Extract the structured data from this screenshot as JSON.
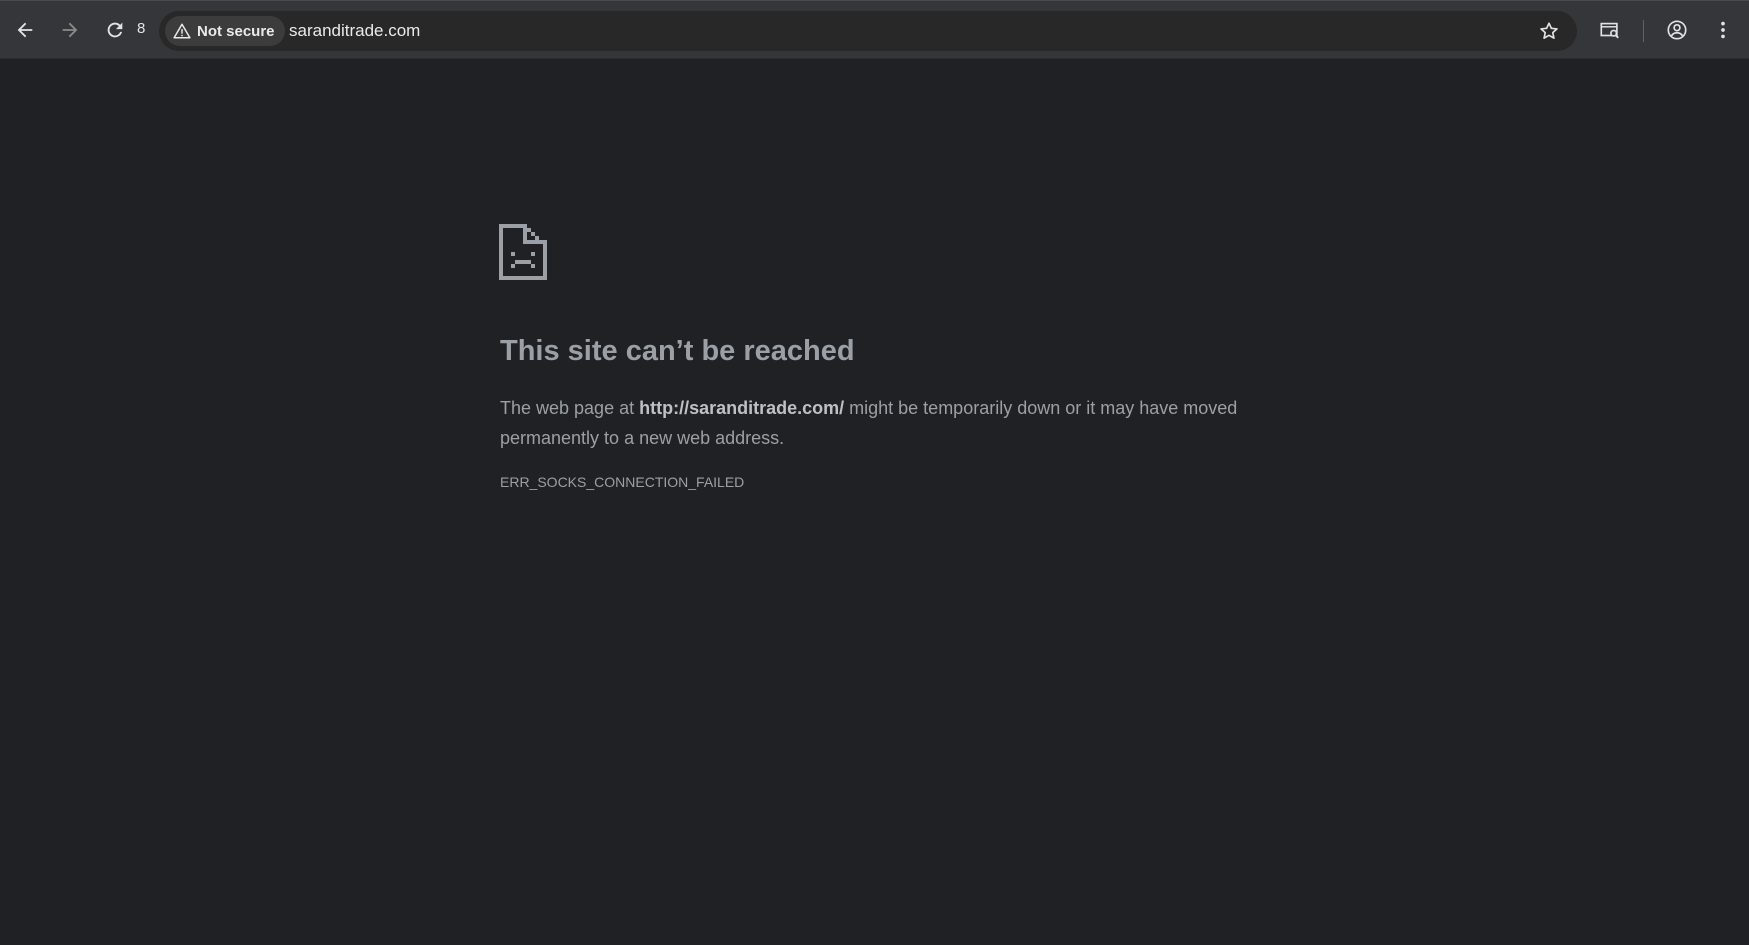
{
  "browser": {
    "reload_count": "8",
    "security_label": "Not secure",
    "url": "saranditrade.com",
    "icons": {
      "back": "arrow-left-icon",
      "forward": "arrow-right-icon",
      "reload": "reload-icon",
      "security": "warning-triangle-icon",
      "bookmark": "star-icon",
      "side_panel": "page-search-icon",
      "profile": "profile-icon",
      "menu": "kebab-menu-icon"
    }
  },
  "error_page": {
    "icon": "sad-document-icon",
    "title": "This site can’t be reached",
    "desc_prefix": "The web page at ",
    "desc_url": "http://saranditrade.com/",
    "desc_suffix": " might be temporarily down or it may have moved permanently to a new web address.",
    "error_code": "ERR_SOCKS_CONNECTION_FAILED"
  },
  "colors": {
    "toolbar_bg": "#35363a",
    "omnibox_bg": "#282828",
    "page_bg": "#202124",
    "text_muted": "#9aa0a6"
  }
}
